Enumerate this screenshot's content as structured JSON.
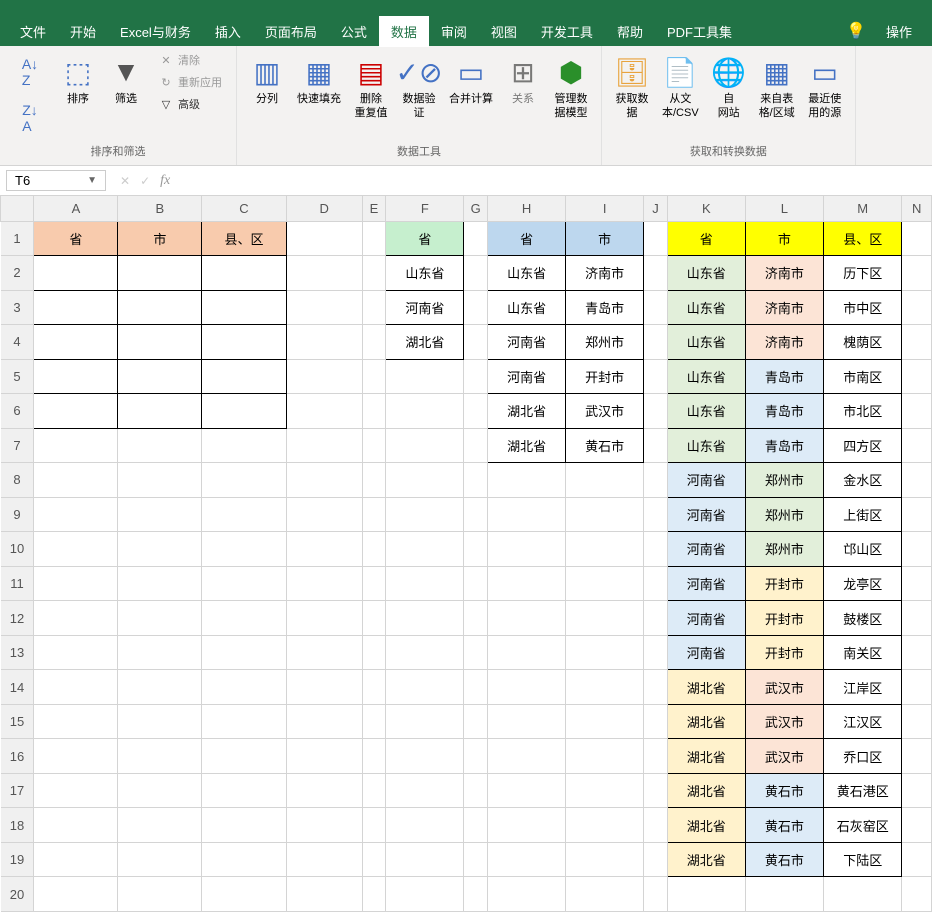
{
  "menubar": {
    "tabs": [
      "文件",
      "开始",
      "Excel与财务",
      "插入",
      "页面布局",
      "公式",
      "数据",
      "审阅",
      "视图",
      "开发工具",
      "帮助",
      "PDF工具集"
    ],
    "active_index": 6,
    "tell_me": "操作"
  },
  "ribbon": {
    "group1": {
      "sort_az": "A↓Z",
      "sort_za": "Z↓A",
      "sort": "排序",
      "filter": "筛选",
      "clear": "清除",
      "reapply": "重新应用",
      "advanced": "高级",
      "label": "排序和筛选"
    },
    "group2": {
      "text_to_col": "分列",
      "flash_fill": "快速填充",
      "remove_dup": "删除\n重复值",
      "data_val": "数据验\n证",
      "consolidate": "合并计算",
      "relations": "关系",
      "data_model": "管理数\n据模型",
      "label": "数据工具"
    },
    "group3": {
      "get_data": "获取数\n据",
      "from_csv": "从文\n本/CSV",
      "from_web": "自\n网站",
      "from_table": "来自表\n格/区域",
      "recent": "最近使\n用的源",
      "label": "获取和转换数据"
    }
  },
  "namebox": "T6",
  "columns": [
    "A",
    "B",
    "C",
    "D",
    "E",
    "F",
    "G",
    "H",
    "I",
    "J",
    "K",
    "L",
    "M",
    "N"
  ],
  "rows_count": 20,
  "headers": {
    "abc": [
      "省",
      "市",
      "县、区"
    ],
    "f": "省",
    "hi": [
      "省",
      "市"
    ],
    "klm": [
      "省",
      "市",
      "县、区"
    ]
  },
  "table_f": [
    "山东省",
    "河南省",
    "湖北省"
  ],
  "table_hi": [
    [
      "山东省",
      "济南市"
    ],
    [
      "山东省",
      "青岛市"
    ],
    [
      "河南省",
      "郑州市"
    ],
    [
      "河南省",
      "开封市"
    ],
    [
      "湖北省",
      "武汉市"
    ],
    [
      "湖北省",
      "黄石市"
    ]
  ],
  "table_klm": [
    {
      "k": "山东省",
      "l": "济南市",
      "m": "历下区",
      "kc": "bg-lgreen",
      "lc": "bg-lorange"
    },
    {
      "k": "山东省",
      "l": "济南市",
      "m": "市中区",
      "kc": "bg-lgreen",
      "lc": "bg-lorange"
    },
    {
      "k": "山东省",
      "l": "济南市",
      "m": "槐荫区",
      "kc": "bg-lgreen",
      "lc": "bg-lorange"
    },
    {
      "k": "山东省",
      "l": "青岛市",
      "m": "市南区",
      "kc": "bg-lgreen",
      "lc": "bg-lblue"
    },
    {
      "k": "山东省",
      "l": "青岛市",
      "m": "市北区",
      "kc": "bg-lgreen",
      "lc": "bg-lblue"
    },
    {
      "k": "山东省",
      "l": "青岛市",
      "m": "四方区",
      "kc": "bg-lgreen",
      "lc": "bg-lblue"
    },
    {
      "k": "河南省",
      "l": "郑州市",
      "m": "金水区",
      "kc": "bg-lblue",
      "lc": "bg-lgreen"
    },
    {
      "k": "河南省",
      "l": "郑州市",
      "m": "上街区",
      "kc": "bg-lblue",
      "lc": "bg-lgreen"
    },
    {
      "k": "河南省",
      "l": "郑州市",
      "m": "邙山区",
      "kc": "bg-lblue",
      "lc": "bg-lgreen"
    },
    {
      "k": "河南省",
      "l": "开封市",
      "m": "龙亭区",
      "kc": "bg-lblue",
      "lc": "bg-lyellow"
    },
    {
      "k": "河南省",
      "l": "开封市",
      "m": "鼓楼区",
      "kc": "bg-lblue",
      "lc": "bg-lyellow"
    },
    {
      "k": "河南省",
      "l": "开封市",
      "m": "南关区",
      "kc": "bg-lblue",
      "lc": "bg-lyellow"
    },
    {
      "k": "湖北省",
      "l": "武汉市",
      "m": "江岸区",
      "kc": "bg-lyellow",
      "lc": "bg-lorange"
    },
    {
      "k": "湖北省",
      "l": "武汉市",
      "m": "江汉区",
      "kc": "bg-lyellow",
      "lc": "bg-lorange"
    },
    {
      "k": "湖北省",
      "l": "武汉市",
      "m": "乔口区",
      "kc": "bg-lyellow",
      "lc": "bg-lorange"
    },
    {
      "k": "湖北省",
      "l": "黄石市",
      "m": "黄石港区",
      "kc": "bg-lyellow",
      "lc": "bg-lblue"
    },
    {
      "k": "湖北省",
      "l": "黄石市",
      "m": "石灰窑区",
      "kc": "bg-lyellow",
      "lc": "bg-lblue"
    },
    {
      "k": "湖北省",
      "l": "黄石市",
      "m": "下陆区",
      "kc": "bg-lyellow",
      "lc": "bg-lblue"
    }
  ]
}
